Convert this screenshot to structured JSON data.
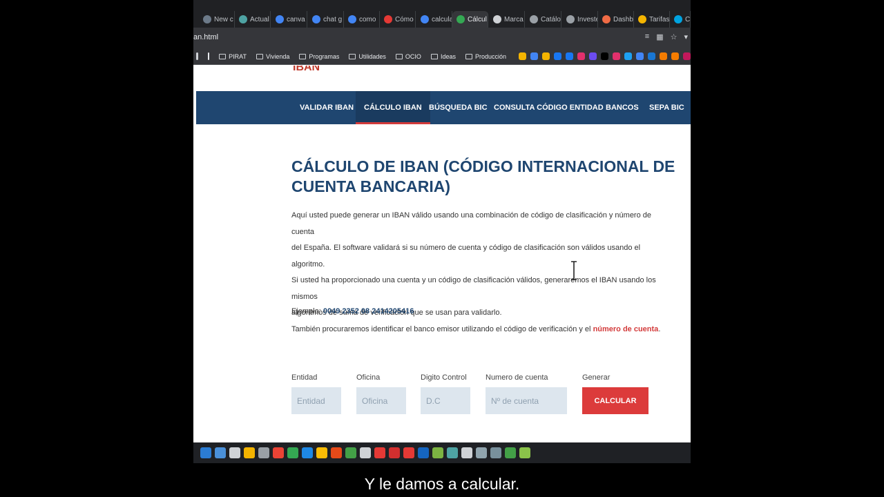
{
  "tabs": [
    {
      "label": "New c",
      "color": "#6c7a89",
      "active": false
    },
    {
      "label": "Actual",
      "color": "#4ea3a3",
      "active": false
    },
    {
      "label": "canva",
      "color": "#4285f4",
      "active": false
    },
    {
      "label": "chat g",
      "color": "#4285f4",
      "active": false
    },
    {
      "label": "como",
      "color": "#4285f4",
      "active": false
    },
    {
      "label": "Cómo",
      "color": "#e53935",
      "active": false
    },
    {
      "label": "calcula",
      "color": "#4285f4",
      "active": false
    },
    {
      "label": "Cálcul",
      "color": "#34a853",
      "active": true
    },
    {
      "label": "Marca",
      "color": "#cfd2d6",
      "active": false
    },
    {
      "label": "Catálo",
      "color": "#9aa0a6",
      "active": false
    },
    {
      "label": "Investe",
      "color": "#9aa0a6",
      "active": false
    },
    {
      "label": "Dashb",
      "color": "#f06b45",
      "active": false
    },
    {
      "label": "Tarifas",
      "color": "#f4b400",
      "active": false
    },
    {
      "label": "C",
      "color": "#00a3e0",
      "active": false
    }
  ],
  "address": {
    "url": "an.html"
  },
  "bookmarks": {
    "folders": [
      "PIRAT",
      "Vivienda",
      "Programas",
      "Utilidades",
      "OCIO",
      "Ideas",
      "Producción"
    ],
    "icon_colors": [
      "#f4b400",
      "#4285f4",
      "#f4b400",
      "#1877f2",
      "#1877f2",
      "#e1306c",
      "#6c4cf1",
      "#000000",
      "#e1306c",
      "#1da1f2",
      "#4285f4",
      "#1976d2",
      "#f57c00",
      "#f57c00",
      "#c2185b"
    ]
  },
  "site": {
    "logo": "IBAN",
    "nav": [
      "VALIDAR IBAN",
      "CÁLCULO IBAN",
      "BÚSQUEDA BIC",
      "CONSULTA CÓDIGO ENTIDAD",
      "BANCOS",
      "SEPA BIC"
    ],
    "active_nav": "CÁLCULO IBAN",
    "title": "CÁLCULO DE IBAN (CÓDIGO INTERNACIONAL DE CUENTA BANCARIA)",
    "paragraph_lines": [
      "Aquí usted puede generar un IBAN válido usando una combinación de código de clasificación y número de cuenta",
      "del España. El software validará si su número de cuenta y código de clasificación son válidos usando el algoritmo.",
      "Si usted ha proporcionado una cuenta y un código de clasificación válidos, generaremos el IBAN usando los mismos",
      "algoritmos de suma de verificación que se usan para validarlo."
    ],
    "last_line_prefix": "También procuraremos identificar el banco emisor utilizando el código de verificación y el ",
    "last_line_link": "número de cuenta",
    "last_line_suffix": ".",
    "example_label": "Ejemplo: ",
    "example_value": "0049 2352 08 2414205416",
    "form": {
      "entidad": {
        "label": "Entidad",
        "placeholder": "Entidad"
      },
      "oficina": {
        "label": "Oficina",
        "placeholder": "Oficina"
      },
      "dc": {
        "label": "Digito Control",
        "placeholder": "D.C"
      },
      "cuenta": {
        "label": "Numero de cuenta",
        "placeholder": "Nº de cuenta"
      },
      "generar": {
        "label": "Generar",
        "button": "CALCULAR"
      }
    }
  },
  "taskbar_icon_colors": [
    "#2b7cd3",
    "#4a90d9",
    "#cfd2d6",
    "#f4b400",
    "#9aa0a6",
    "#ea4335",
    "#34a853",
    "#1e88e5",
    "#fbbc05",
    "#e64a19",
    "#43a047",
    "#cfd2d6",
    "#e53935",
    "#d32f2f",
    "#e53935",
    "#1565c0",
    "#7cb342",
    "#4ea3a3",
    "#cfd2d6",
    "#90a4ae",
    "#78909c",
    "#43a047",
    "#8bc34a"
  ],
  "subtitle": "Y le damos a calcular."
}
